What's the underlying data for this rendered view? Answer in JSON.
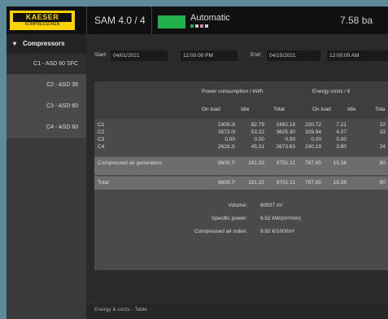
{
  "brand": {
    "name": "KAESER",
    "subtitle": "KOMPRESSOREN"
  },
  "header": {
    "title": "SAM 4.0 / 4",
    "mode": "Automatic",
    "value": "7.58 ba",
    "mode_color": "#22b14c",
    "dot_colors": [
      "#22b14c",
      "#c8c8c8",
      "#e0809a",
      "#c8c8c8"
    ]
  },
  "sidebar": {
    "section": "Compressors",
    "items": [
      "C1 - ASD 60 SFC",
      "C2 - ASD 35",
      "C3 - ASD 60",
      "C4 - ASD 60"
    ]
  },
  "filter": {
    "start_label": "Start:",
    "start_date": "04/01/2021",
    "start_time": "12:00:00 PM",
    "end_label": "End:",
    "end_date": "04/15/2021",
    "end_time": "12:00:00 AM"
  },
  "table": {
    "group_headers": [
      "Power consumption / kWh",
      "Energy costs / €"
    ],
    "sub_headers": [
      "On load",
      "Idle",
      "Total",
      "On load",
      "Idle",
      "Tota"
    ],
    "rows": [
      {
        "label": "C1",
        "values": [
          "2409.39",
          "82.79",
          "2492.18",
          "220.72",
          "7.21",
          "22"
        ]
      },
      {
        "label": "C2",
        "values": [
          "3572.08",
          "53.22",
          "3625.30",
          "326.94",
          "4.37",
          "33"
        ]
      },
      {
        "label": "C3",
        "values": [
          "0.00",
          "0.00",
          "0.00",
          "0.00",
          "0.00",
          ""
        ]
      },
      {
        "label": "C4",
        "values": [
          "2628.32",
          "45.31",
          "2673.63",
          "240.19",
          "3.80",
          "24"
        ]
      },
      {
        "label": "Compressed air generators",
        "values": [
          "8609.79",
          "181.32",
          "8791.11",
          "787.85",
          "15.38",
          "80"
        ]
      },
      {
        "label": "Total",
        "values": [
          "8609.79",
          "181.32",
          "8791.11",
          "787.85",
          "15.38",
          "80"
        ]
      }
    ],
    "stats": [
      {
        "label": "Volume:",
        "value": "80937 m³"
      },
      {
        "label": "Specific power:",
        "value": "6.52 kW/(m³/min)"
      },
      {
        "label": "Compressed air index:",
        "value": "9.92 €/1000m³"
      }
    ]
  },
  "footer": {
    "text": "Energy & costs - Table"
  }
}
